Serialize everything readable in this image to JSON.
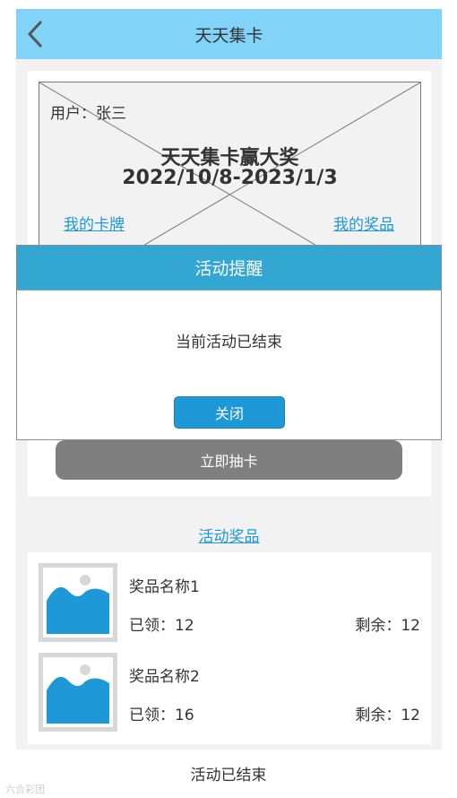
{
  "header": {
    "title": "天天集卡",
    "back_icon": "chevron-left-icon"
  },
  "banner": {
    "user_label": "用户：张三",
    "title": "天天集卡赢大奖",
    "date_range": "2022/10/8-2023/1/3",
    "my_cards": "我的卡牌",
    "my_prizes": "我的奖品"
  },
  "draw_button": "立即抽卡",
  "prizes_link": "活动奖品",
  "prizes": [
    {
      "name": "奖品名称1",
      "claimed": "已领：12",
      "remaining": "剩余：12"
    },
    {
      "name": "奖品名称2",
      "claimed": "已领：16",
      "remaining": "剩余：12"
    }
  ],
  "footer": "活动已结束",
  "watermark": "六合彩团",
  "modal": {
    "title": "活动提醒",
    "message": "当前活动已结束",
    "close_label": "关闭"
  },
  "colors": {
    "header_bg": "#81d3f8",
    "modal_header_bg": "#33a7d1",
    "primary_button": "#1e98d7",
    "disabled_button": "#7f7f7f",
    "link": "#1e98d7",
    "page_bg": "#f2f2f2"
  }
}
